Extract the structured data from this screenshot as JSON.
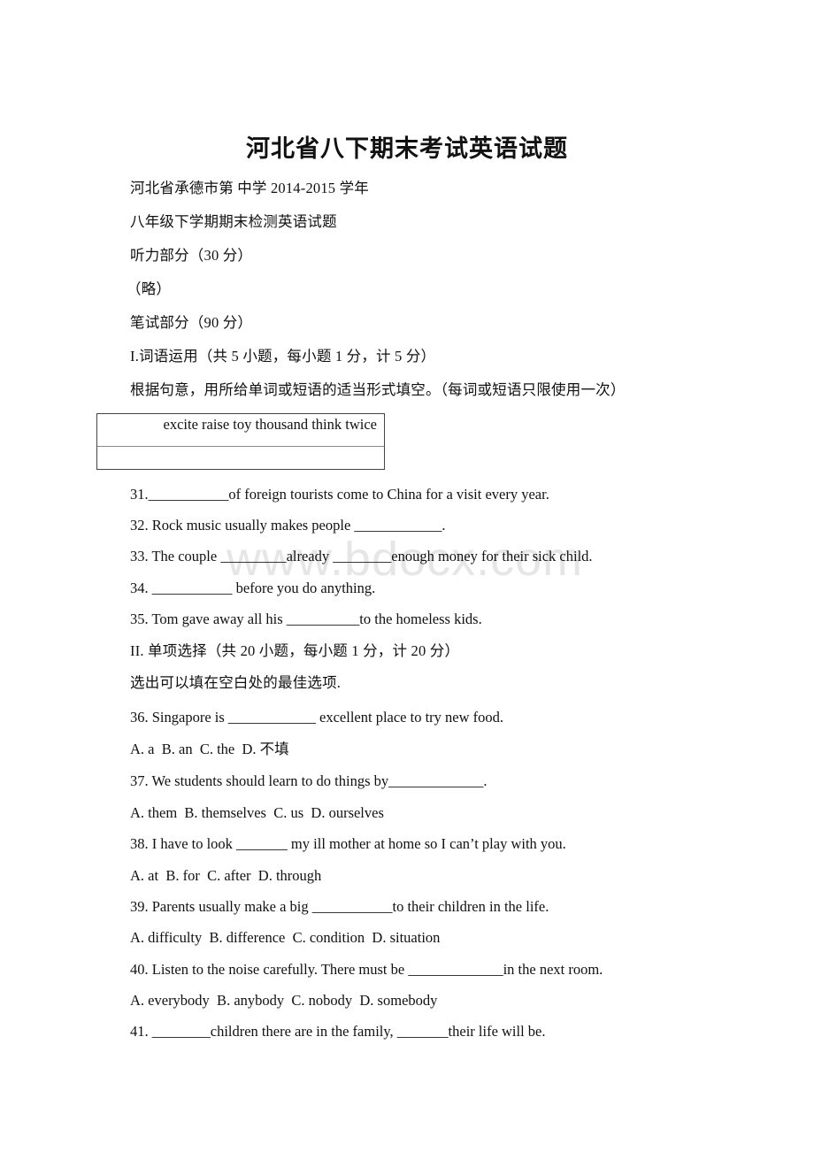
{
  "document": {
    "title": "河北省八下期末考试英语试题",
    "watermark": "www.bdocx.com",
    "header_lines": [
      "河北省承德市第 中学 2014-2015 学年",
      "八年级下学期期末检测英语试题",
      "听力部分（30 分）",
      "（略）",
      "笔试部分（90 分）"
    ],
    "section1": {
      "heading": "I.词语运用（共 5 小题，每小题 1 分，计 5 分）",
      "instruction": "根据句意，用所给单词或短语的适当形式填空。（每词或短语只限使用一次）",
      "word_bank": "excite raise toy thousand think twice",
      "questions": [
        "31.___________of foreign tourists come to China for a visit every year.",
        "32. Rock music usually makes people ____________.",
        "33. The couple _________already ________enough money for their sick child.",
        "34. ___________ before you do anything.",
        "35. Tom gave away all his __________to the homeless kids."
      ]
    },
    "section2": {
      "heading": "II. 单项选择（共 20 小题，每小题 1 分，计 20 分）",
      "instruction": "选出可以填在空白处的最佳选项.",
      "items": [
        {
          "question": "36. Singapore is ____________ excellent place to try new food.",
          "options": "A. a  B. an  C. the  D. 不填"
        },
        {
          "question": "37. We students should learn to do things by_____________.",
          "options": "A. them  B. themselves  C. us  D. ourselves"
        },
        {
          "question": "38. I have to look _______ my ill mother at home so I can’t play with you.",
          "options": "A. at  B. for  C. after  D. through"
        },
        {
          "question": "39. Parents usually make a big ___________to their children in the life.",
          "options": "A. difficulty  B. difference  C. condition  D. situation"
        },
        {
          "question": "40. Listen to the noise carefully. There must be _____________in the next room.",
          "options": "A. everybody  B. anybody  C. nobody  D. somebody"
        },
        {
          "question": "41. ________children there are in the family, _______their life will be.",
          "options": null
        }
      ]
    }
  }
}
